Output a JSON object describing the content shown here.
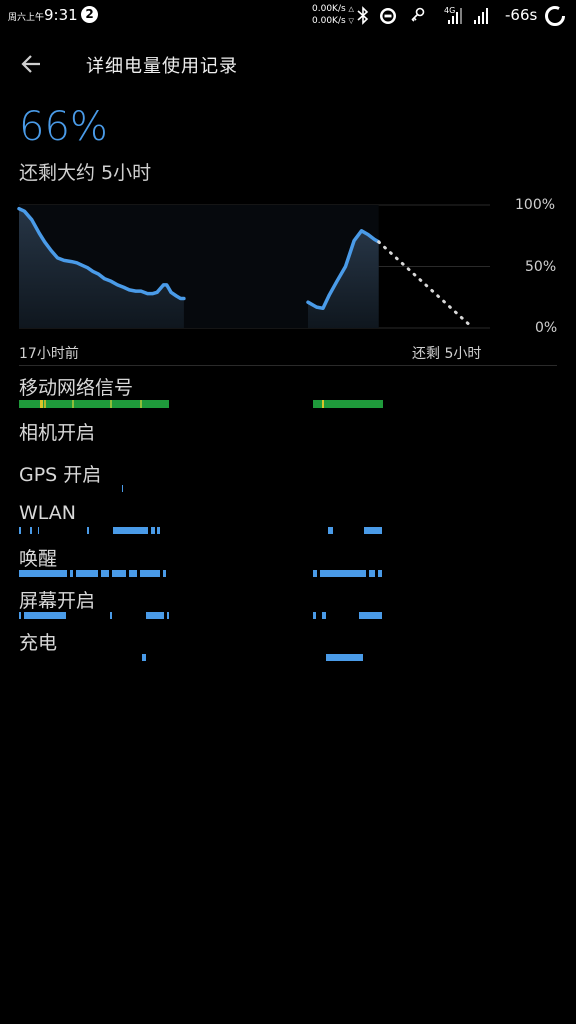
{
  "status_bar": {
    "date_prefix": "周六上午",
    "time": "9:31",
    "badge": "2",
    "speed_up": "0.00K/s",
    "speed_down": "0.00K/s",
    "network_type": "4G",
    "signal_value": "-66s"
  },
  "header": {
    "title": "详细电量使用记录",
    "back_icon": "arrow-left-icon"
  },
  "battery": {
    "level": "66%",
    "remaining": "还剩大约 5小时"
  },
  "chart_data": {
    "type": "line",
    "y_tick_labels": [
      "100%",
      "50%",
      "0%"
    ],
    "x_start_label": "17小时前",
    "x_end_label": "还剩 5小时",
    "ylim": [
      0,
      100
    ],
    "xlim": [
      0,
      22
    ],
    "series": [
      {
        "segment": "history_1",
        "x": [
          0,
          0.5,
          1.2,
          1.9,
          2.4,
          3.0,
          3.6,
          4.2,
          4.9,
          5.4,
          5.9,
          6.4,
          6.9,
          7.4,
          8.0,
          8.6,
          9.2,
          9.8,
          10.3,
          10.9,
          11.4,
          12.0,
          12.5,
          12.9,
          13.5,
          13.8,
          14.0,
          14.2,
          14.7,
          15.1,
          15.4
        ],
        "y": [
          97,
          95,
          88,
          77,
          70,
          63,
          57,
          55,
          54,
          53,
          51,
          49,
          46,
          44,
          40,
          38,
          35,
          33,
          31,
          30,
          30,
          28,
          28,
          29,
          35,
          35,
          32,
          29,
          26,
          24,
          24
        ]
      },
      {
        "segment": "history_2",
        "x": [
          27.0,
          27.8,
          28.4,
          29.0,
          29.7,
          30.5,
          31.3,
          32.0,
          32.6,
          33.2,
          33.6
        ],
        "y": [
          21,
          17,
          16,
          27,
          38,
          50,
          71,
          79,
          76,
          72,
          70
        ]
      },
      {
        "segment": "prediction",
        "x": [
          33.6,
          42.4
        ],
        "y": [
          70,
          0
        ]
      }
    ]
  },
  "tracks": [
    {
      "label": "移动网络信号"
    },
    {
      "label": "相机开启"
    },
    {
      "label": "GPS 开启"
    },
    {
      "label": "WLAN"
    },
    {
      "label": "唤醒"
    },
    {
      "label": "屏幕开启"
    },
    {
      "label": "充电"
    }
  ],
  "colors": {
    "accent": "#4a9be8",
    "signal_green": "#1f9a3b",
    "signal_yellow": "#d8c42a"
  }
}
